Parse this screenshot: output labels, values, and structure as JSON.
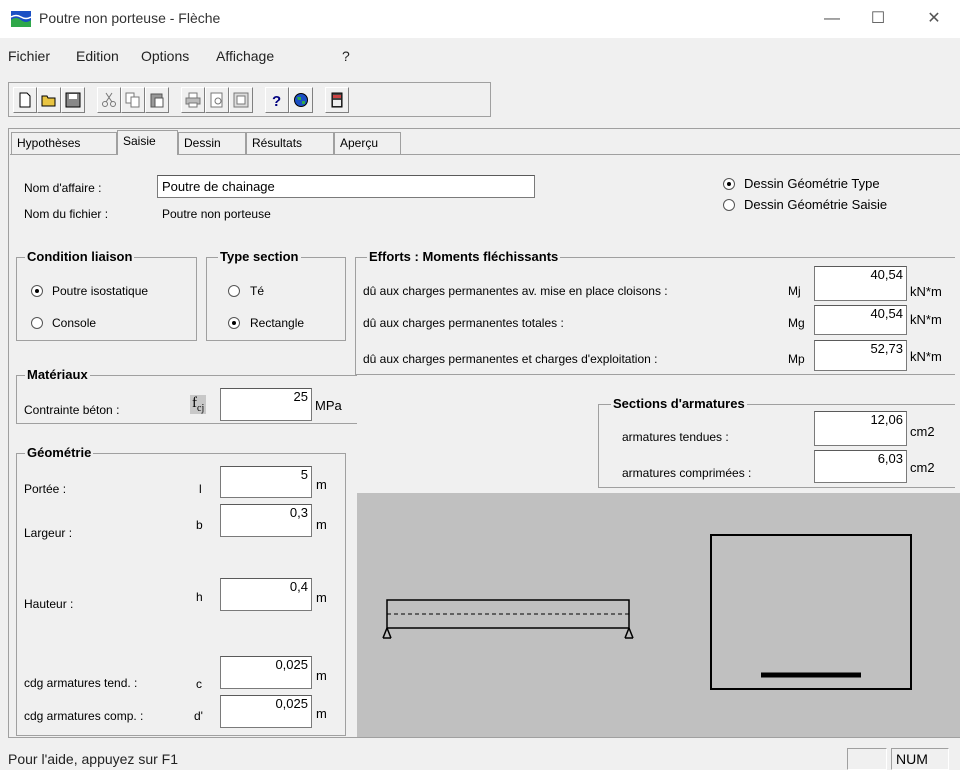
{
  "window": {
    "title": "Poutre non porteuse - Flèche",
    "minimize": "—",
    "maximize": "☐",
    "close": "✕"
  },
  "menu": [
    "Fichier",
    "Edition",
    "Options",
    "Affichage",
    "?"
  ],
  "tabs": [
    "Hypothèses",
    "Saisie",
    "Dessin",
    "Résultats",
    "Aperçu"
  ],
  "header": {
    "nom_affaire_label": "Nom d'affaire :",
    "nom_affaire_value": "Poutre de chainage",
    "nom_fichier_label": "Nom du fichier :",
    "nom_fichier_value": "Poutre non porteuse",
    "dessin_type": "Dessin Géométrie Type",
    "dessin_saisie": "Dessin Géométrie Saisie"
  },
  "condition": {
    "title": "Condition liaison",
    "opt1": "Poutre isostatique",
    "opt2": "Console"
  },
  "type_section": {
    "title": "Type section",
    "opt1": "Té",
    "opt2": "Rectangle"
  },
  "efforts": {
    "title": "Efforts : Moments fléchissants",
    "rows": [
      {
        "label": "dû aux charges permanentes av. mise en place cloisons :",
        "sym": "Mj",
        "value": "40,54",
        "unit": "kN*m"
      },
      {
        "label": "dû aux charges permanentes totales :",
        "sym": "Mg",
        "value": "40,54",
        "unit": "kN*m"
      },
      {
        "label": "dû aux charges permanentes et charges d'exploitation :",
        "sym": "Mp",
        "value": "52,73",
        "unit": "kN*m"
      }
    ]
  },
  "materiaux": {
    "title": "Matériaux",
    "label": "Contrainte béton :",
    "sym": "f",
    "sub": "cj",
    "value": "25",
    "unit": "MPa"
  },
  "sections": {
    "title": "Sections d'armatures",
    "rows": [
      {
        "label": "armatures tendues :",
        "value": "12,06",
        "unit": "cm2"
      },
      {
        "label": "armatures comprimées :",
        "value": "6,03",
        "unit": "cm2"
      }
    ]
  },
  "geometrie": {
    "title": "Géométrie",
    "rows": [
      {
        "label": "Portée :",
        "sym": "l",
        "value": "5",
        "unit": "m"
      },
      {
        "label": "Largeur :",
        "sym": "b",
        "value": "0,3",
        "unit": "m"
      },
      {
        "label": "Hauteur :",
        "sym": "h",
        "value": "0,4",
        "unit": "m"
      },
      {
        "label": "cdg armatures tend. :",
        "sym": "c",
        "value": "0,025",
        "unit": "m"
      },
      {
        "label": "cdg armatures comp. :",
        "sym": "d'",
        "value": "0,025",
        "unit": "m"
      }
    ]
  },
  "status": {
    "text": "Pour l'aide, appuyez sur F1",
    "num": "NUM"
  }
}
